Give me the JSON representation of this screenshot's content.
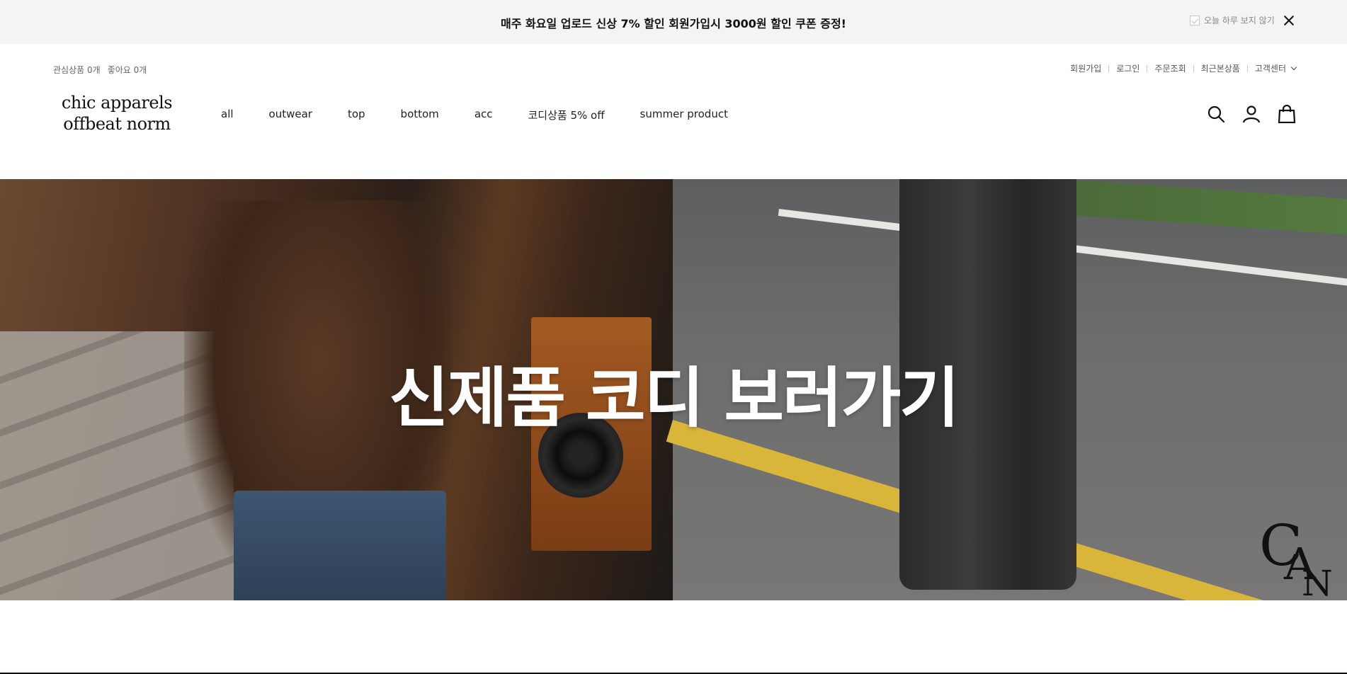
{
  "announcement": {
    "message": "매주 화요일 업로드 신상 7% 할인 회원가입시 3000원 할인 쿠폰 증정!",
    "dismiss_label": "오늘 하루 보지 않기"
  },
  "header": {
    "util_left": {
      "wishlist": "관심상품 0개",
      "likes": "좋아요 0개"
    },
    "util_right": [
      "회원가입",
      "로그인",
      "주문조회",
      "최근본상품",
      "고객센터"
    ],
    "logo_line1": "chic apparels",
    "logo_line2": "offbeat norm",
    "nav": [
      "all",
      "outwear",
      "top",
      "bottom",
      "acc",
      "코디상품 5% off",
      "summer product"
    ],
    "icons": [
      "search-icon",
      "user-icon",
      "bag-icon"
    ]
  },
  "hero": {
    "title": "신제품 코디 보러가기"
  }
}
